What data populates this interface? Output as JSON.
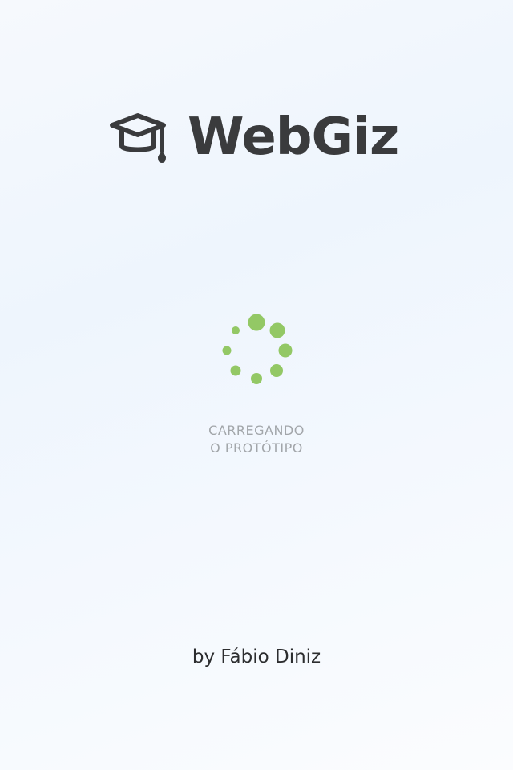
{
  "brand": {
    "name": "WebGiz",
    "icon": "graduation-cap-icon",
    "color": "#3a3b3d"
  },
  "loader": {
    "icon": "loading-spinner",
    "color": "#93c865",
    "line1": "CARREGANDO",
    "line2": "O PROTÓTIPO"
  },
  "footer": {
    "credit": "by Fábio Diniz"
  }
}
